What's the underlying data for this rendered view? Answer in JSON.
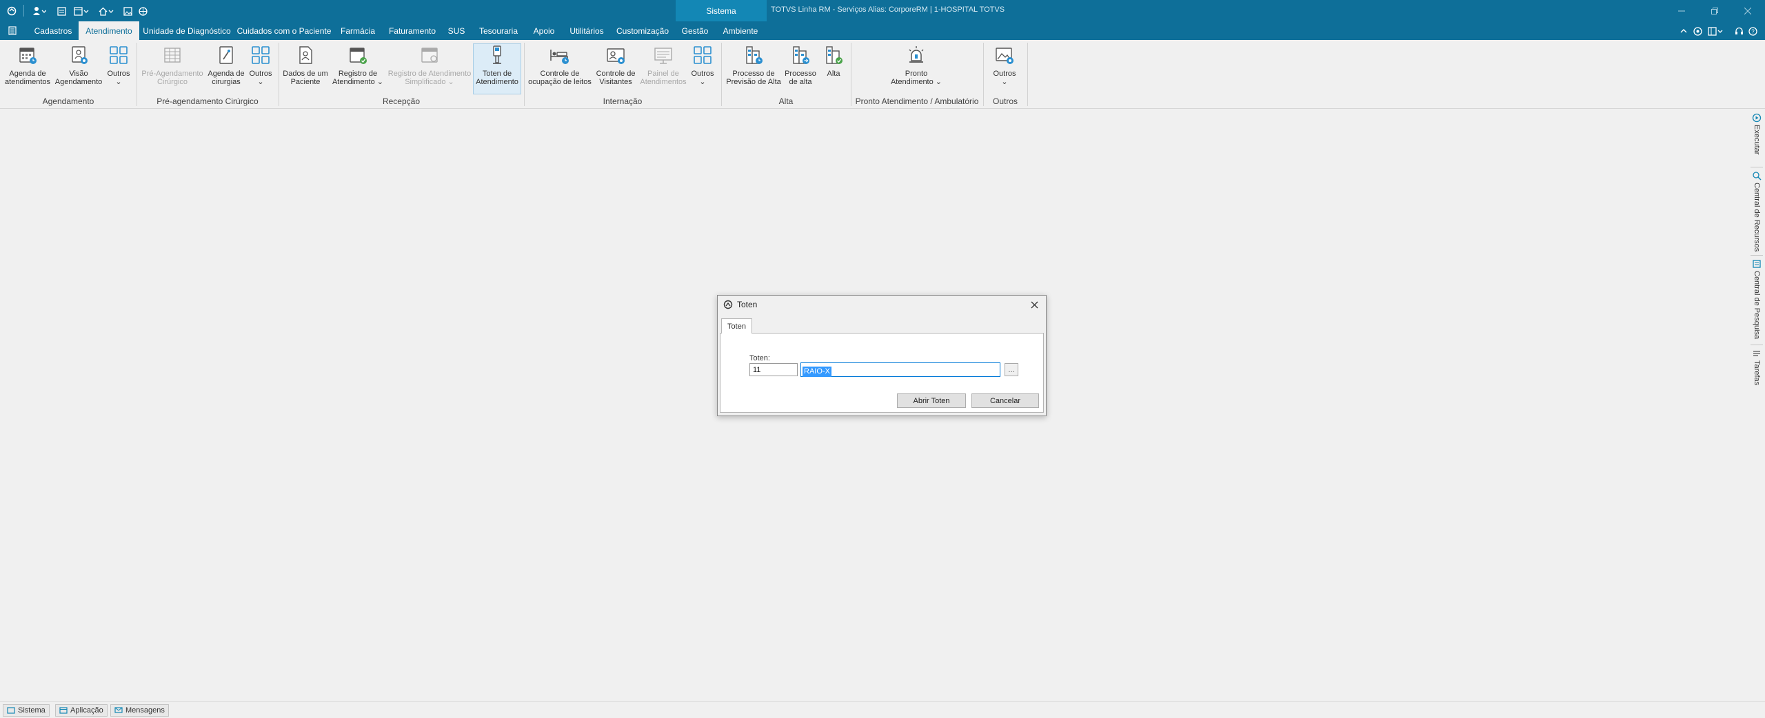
{
  "titlebar": {
    "system_tab": "Sistema",
    "title": "TOTVS Linha RM - Serviços  Alias: CorporeRM | 1-HOSPITAL TOTVS"
  },
  "menu": {
    "items": [
      "Cadastros",
      "Atendimento",
      "Unidade de Diagnóstico",
      "Cuidados com o Paciente",
      "Farmácia",
      "Faturamento",
      "SUS",
      "Tesouraria",
      "Apoio",
      "Utilitários",
      "Customização",
      "Gestão",
      "Ambiente"
    ],
    "active": "Atendimento"
  },
  "ribbon": {
    "buttons": [
      {
        "label": "Agenda de\natendimentos"
      },
      {
        "label": "Visão\nAgendamento"
      },
      {
        "label": "Outros\n⌄"
      },
      {
        "label": "Pré-Agendamento\nCirúrgico"
      },
      {
        "label": "Agenda de\ncirurgias"
      },
      {
        "label": "Outros\n⌄"
      },
      {
        "label": "Dados de um\nPaciente"
      },
      {
        "label": "Registro de\nAtendimento ⌄"
      },
      {
        "label": "Registro de Atendimento\nSimplificado ⌄"
      },
      {
        "label": "Toten de\nAtendimento"
      },
      {
        "label": "Controle de\nocupação de leitos"
      },
      {
        "label": "Controle de\nVisitantes"
      },
      {
        "label": "Painel de\nAtendimentos"
      },
      {
        "label": "Outros\n⌄"
      },
      {
        "label": "Processo de\nPrevisão de Alta"
      },
      {
        "label": "Processo\nde alta"
      },
      {
        "label": "Alta"
      },
      {
        "label": "Pronto\nAtendimento ⌄"
      },
      {
        "label": "Outros\n⌄"
      }
    ],
    "groups": [
      "Agendamento",
      "Pré-agendamento Cirúrgico",
      "Recepção",
      "Internação",
      "Alta",
      "Pronto Atendimento / Ambulatório",
      "Outros"
    ]
  },
  "side_panel": {
    "tabs": [
      "Executar",
      "Central de Recursos",
      "Central de Pesquisa",
      "Tarefas"
    ]
  },
  "dialog": {
    "title": "Toten",
    "tab": "Toten",
    "field_label": "Toten:",
    "code_value": "11",
    "name_value": "RAIO-X",
    "lookup_label": "...",
    "open_button": "Abrir Toten",
    "cancel_button": "Cancelar"
  },
  "statusbar": {
    "items": [
      "Sistema",
      "Aplicação",
      "Mensagens"
    ]
  },
  "colors": {
    "titlebar": "#0e6f99",
    "accent": "#1387b5",
    "icon_blue": "#2a8fd0",
    "icon_green": "#4aa34a"
  }
}
